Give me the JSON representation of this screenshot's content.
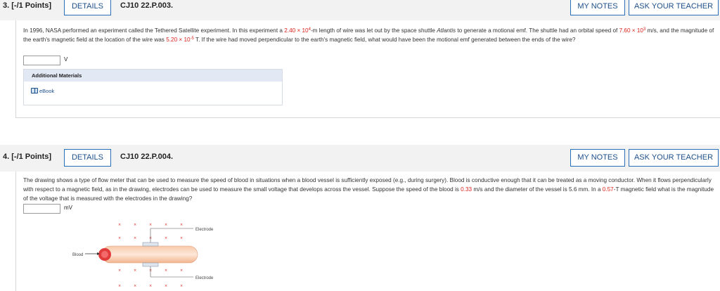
{
  "q3": {
    "number": "3.",
    "points": "[-/1 Points]",
    "details_label": "DETAILS",
    "code": "CJ10 22.P.003.",
    "my_notes_label": "MY NOTES",
    "ask_label": "ASK YOUR TEACHER",
    "text": {
      "p1": "In 1996, NASA performed an experiment called the Tethered Satellite experiment. In this experiment a ",
      "length_val": "2.40 × 10",
      "length_exp": "4",
      "p2": "-m length of wire was let out by the space shuttle ",
      "shuttle": "Atlantis",
      "p3": " to generate a motional emf. The shuttle had an orbital speed of ",
      "speed_val": "7.60 × 10",
      "speed_exp": "3",
      "p4": " m/s, and the magnitude of the earth's magnetic field at the location of the wire was ",
      "field_val": "5.20 × 10",
      "field_exp": "-5",
      "p5": " T. If the wire had moved perpendicular to the earth's magnetic field, what would have been the motional emf generated between the ends of the wire?"
    },
    "answer_value": "",
    "unit": "V",
    "additional_materials_label": "Additional Materials",
    "ebook_label": "eBook"
  },
  "q4": {
    "number": "4.",
    "points": "[-/1 Points]",
    "details_label": "DETAILS",
    "code": "CJ10 22.P.004.",
    "my_notes_label": "MY NOTES",
    "ask_label": "ASK YOUR TEACHER",
    "text": {
      "p1": "The drawing shows a type of flow meter that can be used to measure the speed of blood in situations when a blood vessel is sufficiently exposed (e.g., during surgery). Blood is conductive enough that it can be treated as a moving conductor. When it flows perpendicularly with respect to a magnetic field, as in the drawing, electrodes can be used to measure the small voltage that develops across the vessel. Suppose the speed of the blood is ",
      "speed_val": "0.33",
      "p2": " m/s and the diameter of the vessel is 5.6 mm. In a ",
      "field_val": "0.57",
      "p3": "-T magnetic field what is the magnitude of the voltage that is measured with the electrodes in the drawing?"
    },
    "answer_value": "",
    "unit": "mV",
    "figure": {
      "electrode_top": "Electrode",
      "electrode_bottom": "Electrode",
      "blood_label": "Blood"
    }
  },
  "colors": {
    "accent_blue": "#2a6fb5",
    "highlight_red": "#d9231c",
    "header_gray": "#f2f2f2",
    "panel_blue": "#e3e8f5"
  }
}
